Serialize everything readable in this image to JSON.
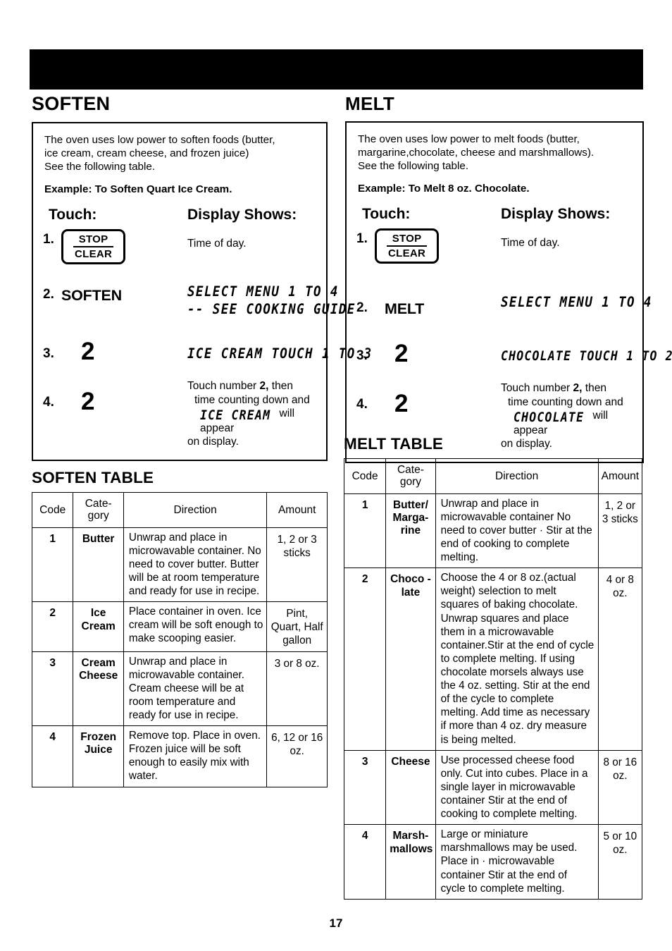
{
  "page": {
    "number": "17",
    "banner_color": "#000000"
  },
  "soften": {
    "title": "SOFTEN",
    "intro_line1": "The oven uses low power to soften foods (butter,",
    "intro_line2": "ice cream, cream cheese, and frozen juice)",
    "intro_line3": "See the following table.",
    "example": "Example: To Soften Quart Ice Cream.",
    "col_touch": "Touch:",
    "col_display": "Display Shows:",
    "steps": {
      "s1_num": "1.",
      "s1_key_top": "STOP",
      "s1_key_bottom": "CLEAR",
      "s1_display": "Time of day.",
      "s2_num": "2.",
      "s2_pad": "SOFTEN",
      "s2_display_line1": "SELECT MENU 1 TO 4",
      "s2_display_line2": "-- SEE COOKING GUIDE",
      "s3_num": "3.",
      "s3_pad": "2",
      "s3_display": "ICE CREAM TOUCH 1 TO 3",
      "s4_num": "4.",
      "s4_pad": "2",
      "s4_note_a": "Touch number ",
      "s4_note_b": "2,",
      "s4_note_c": " then",
      "s4_note_line2": "time counting down and",
      "s4_note_lcd": "ICE CREAM",
      "s4_note_after_lcd": "will appear",
      "s4_note_line4": "on display."
    }
  },
  "melt": {
    "title": "MELT",
    "intro_line1": "The oven uses low power to melt foods (butter,",
    "intro_line2": "margarine,chocolate, cheese and marshmallows).",
    "intro_line3": "See the following table.",
    "example": "Example: To Melt 8 oz. Chocolate.",
    "col_touch": "Touch:",
    "col_display": "Display Shows:",
    "steps": {
      "s1_num": "1.",
      "s1_key_top": "STOP",
      "s1_key_bottom": "CLEAR",
      "s1_display": "Time of day.",
      "s2_num": "2.",
      "s2_pad": "MELT",
      "s2_display_line1": "SELECT MENU 1 TO 4",
      "s3_num": "3.",
      "s3_pad": "2",
      "s3_display": "CHOCOLATE TOUCH 1 TO 2",
      "s4_num": "4.",
      "s4_pad": "2",
      "s4_note_a": "Touch number ",
      "s4_note_b": "2,",
      "s4_note_c": " then",
      "s4_note_line2": "time counting down and",
      "s4_note_lcd": "CHOCOLATE",
      "s4_note_after_lcd": "will appear",
      "s4_note_line4": "on display."
    }
  },
  "soften_table": {
    "title": "SOFTEN TABLE",
    "headers": [
      "Code",
      "Cate-\ngory",
      "Direction",
      "Amount"
    ],
    "header_code": "Code",
    "header_category_l1": "Cate-",
    "header_category_l2": "gory",
    "header_direction": "Direction",
    "header_amount": "Amount",
    "rows": [
      {
        "code": "1",
        "category": "Butter",
        "direction": "Unwrap and place in microwavable container. No need to cover butter. Butter will be at room temperature and ready for use in recipe.",
        "amount": "1, 2 or 3 sticks"
      },
      {
        "code": "2",
        "category": "Ice Cream",
        "direction": "Place container in oven. Ice cream will be soft enough to make scooping easier.",
        "amount": "Pint, Quart, Half gallon"
      },
      {
        "code": "3",
        "category": "Cream Cheese",
        "direction": "Unwrap and place in microwavable container. Cream cheese will be at room temperature and ready for use in recipe.",
        "amount": "3 or 8 oz."
      },
      {
        "code": "4",
        "category": "Frozen Juice",
        "direction": "Remove top. Place in oven. Frozen juice will be soft enough to easily mix with water.",
        "amount": "6, 12 or 16 oz."
      }
    ]
  },
  "melt_table": {
    "title": "MELT TABLE",
    "header_code": "Code",
    "header_category_l1": "Cate-",
    "header_category_l2": "gory",
    "header_direction": "Direction",
    "header_amount": "Amount",
    "rows": [
      {
        "code": "1",
        "category": "Butter/ Marga- rine",
        "direction": "Unwrap and place in microwavable container No need to cover butter · Stir at the end of cooking to complete melting.",
        "amount": "1, 2 or 3 sticks"
      },
      {
        "code": "2",
        "category": "Choco - late",
        "direction": "Choose the 4 or 8 oz.(actual weight) selection to melt squares of baking chocolate. Unwrap squares and place them in a microwavable container.Stir at the end of cycle to complete melting. If using chocolate morsels always use the 4 oz. setting. Stir at the end of the cycle to complete melting.  Add time as necessary if more than 4 oz. dry measure is being melted.",
        "amount": "4 or 8 oz."
      },
      {
        "code": "3",
        "category": "Cheese",
        "direction": "Use processed cheese food only. Cut into cubes. Place in a single layer in microwavable container Stir at the end of cooking to complete melting.",
        "amount": "8 or 16 oz."
      },
      {
        "code": "4",
        "category": "Marsh- mallows",
        "direction": "Large or miniature marshmallows may be used. Place in               · microwavable container Stir at the end of cycle to complete melting.",
        "amount": "5 or 10 oz."
      }
    ]
  }
}
